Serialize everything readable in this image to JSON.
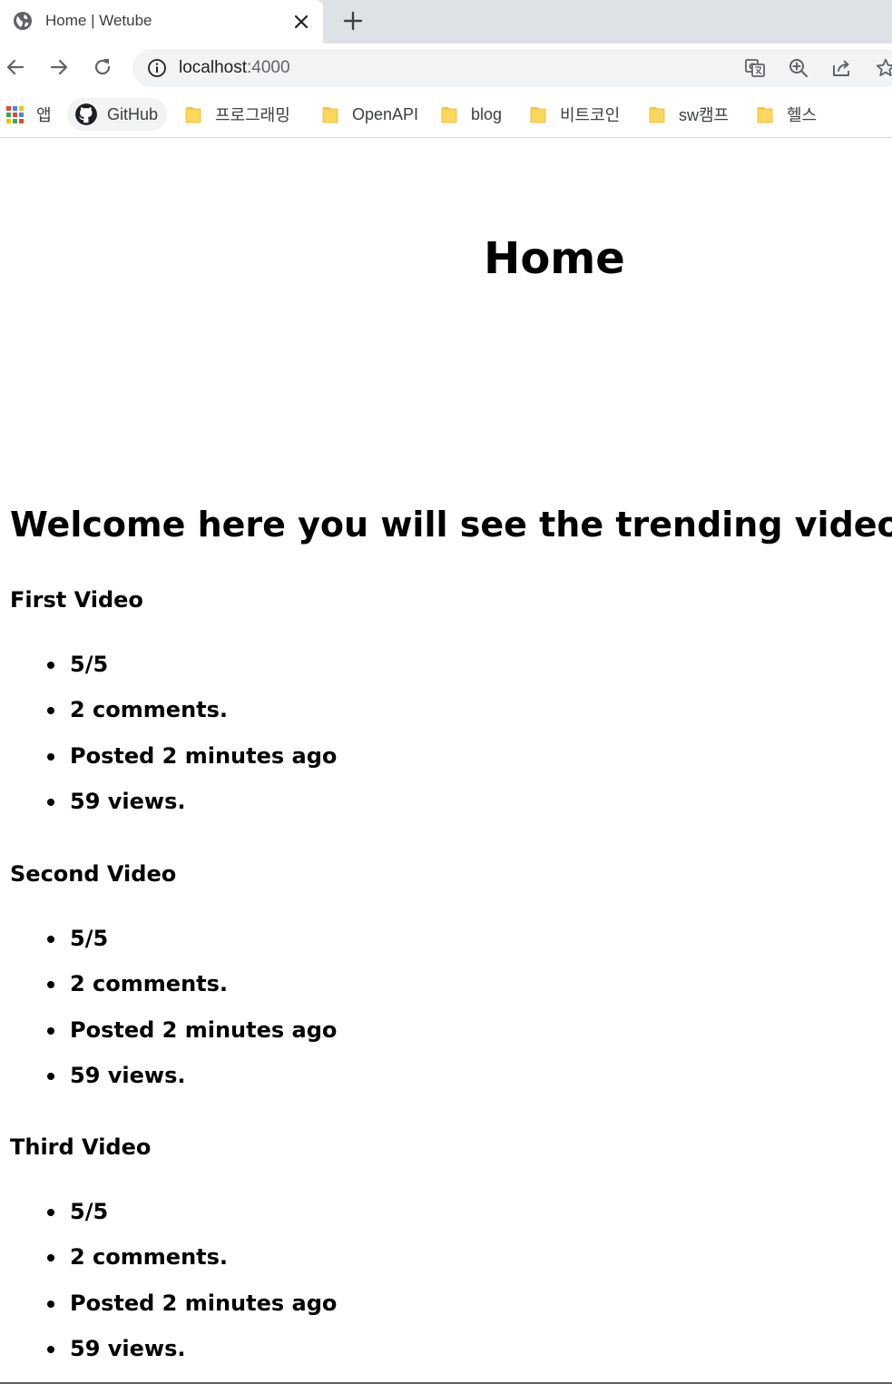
{
  "browser": {
    "tab": {
      "title": "Home | Wetube",
      "favicon": "globe-icon",
      "close": "close-icon"
    },
    "new_tab": "plus-icon",
    "toolbar": {
      "back": "arrow-left-icon",
      "forward": "arrow-right-icon",
      "reload": "reload-icon",
      "url_host": "localhost",
      "url_port": ":4000",
      "icons": [
        "translate-icon",
        "zoom-icon",
        "share-icon",
        "star-icon"
      ]
    },
    "bookmarks": [
      {
        "label": "앱",
        "icon": "apps-icon"
      },
      {
        "label": "GitHub",
        "icon": "github-icon"
      },
      {
        "label": "프로그래밍",
        "icon": "folder-icon"
      },
      {
        "label": "OpenAPI",
        "icon": "folder-icon"
      },
      {
        "label": "blog",
        "icon": "folder-icon"
      },
      {
        "label": "비트코인",
        "icon": "folder-icon"
      },
      {
        "label": "sw캠프",
        "icon": "folder-icon"
      },
      {
        "label": "헬스",
        "icon": "folder-icon"
      }
    ]
  },
  "page": {
    "title": "Home",
    "welcome": "Welcome here you will see the trending videos.",
    "videos": [
      {
        "title": "First Video",
        "stats": [
          "5/5",
          "2 comments.",
          "Posted 2 minutes ago",
          "59 views."
        ]
      },
      {
        "title": "Second Video",
        "stats": [
          "5/5",
          "2 comments.",
          "Posted 2 minutes ago",
          "59 views."
        ]
      },
      {
        "title": "Third Video",
        "stats": [
          "5/5",
          "2 comments.",
          "Posted 2 minutes ago",
          "59 views."
        ]
      }
    ]
  },
  "colors": {
    "chrome_bg": "#dee1e6",
    "omnibox_bg": "#f1f3f4",
    "folder": "#fbd75b",
    "text": "#000000"
  }
}
